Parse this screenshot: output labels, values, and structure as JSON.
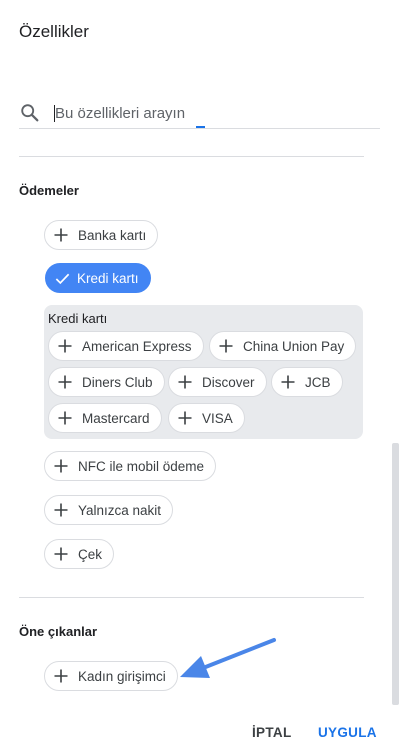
{
  "dialog": {
    "title": "Özellikler"
  },
  "search": {
    "placeholder": "Bu özellikleri arayın",
    "value": ""
  },
  "sections": {
    "payments": {
      "heading": "Ödemeler",
      "bank_card": "Banka kartı",
      "credit_card": "Kredi kartı",
      "credit_card_selected": true,
      "subpanel_label": "Kredi kartı",
      "card_types": [
        "American Express",
        "China Union Pay",
        "Diners Club",
        "Discover",
        "JCB",
        "Mastercard",
        "VISA"
      ],
      "nfc": "NFC ile mobil ödeme",
      "cash_only": "Yalnızca nakit",
      "cheque": "Çek"
    },
    "highlights": {
      "heading": "Öne çıkanlar",
      "women_led": "Kadın girişimci"
    }
  },
  "footer": {
    "cancel_label": "İPTAL",
    "apply_label": "UYGULA"
  },
  "colors": {
    "accent": "#1a73e8",
    "selected_chip": "#4285f4",
    "subpanel_bg": "#e8eaed",
    "annotation_arrow": "#4a86e8"
  },
  "icons": {
    "search": "search-icon",
    "add": "plus-icon",
    "selected": "check-icon",
    "annotation": "arrow-icon"
  }
}
